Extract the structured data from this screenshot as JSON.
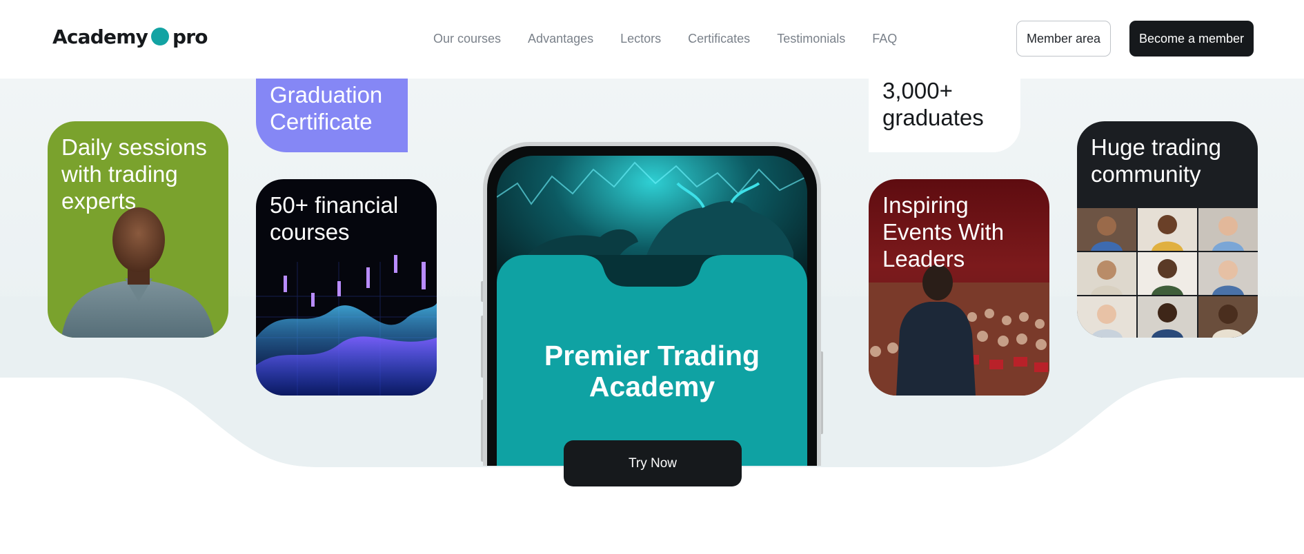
{
  "header": {
    "logo_left": "Academy",
    "logo_right": "pro",
    "nav": [
      "Our courses",
      "Advantages",
      "Lectors",
      "Certificates",
      "Testimonials",
      "FAQ"
    ],
    "member_area": "Member area",
    "become_member": "Become a member"
  },
  "cards": {
    "daily": "Daily sessions with trading experts",
    "graduation": "Graduation Certificate",
    "courses": "50+ financial courses",
    "graduates": "3,000+ graduates",
    "events": "Inspiring Events With Leaders",
    "community": "Huge trading community"
  },
  "phone": {
    "title": "Premier Trading Academy"
  },
  "cta": {
    "try_now": "Try Now"
  },
  "colors": {
    "accent_teal": "#13a3a3",
    "daily_green": "#7aa22d",
    "graduation_purple": "#8587f5",
    "dark": "#16191c",
    "events_red": "#5e0c10"
  }
}
